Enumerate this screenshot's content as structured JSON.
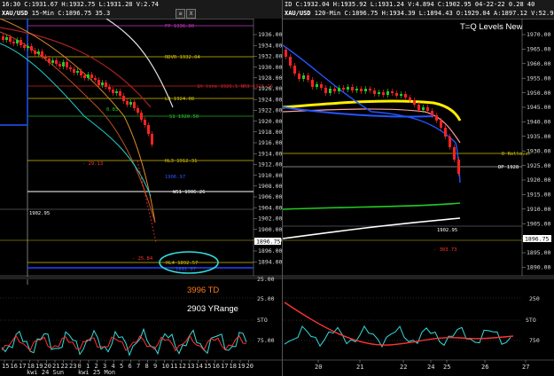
{
  "left": {
    "header_line1": "16:30 C:1931.67 H:1932.75 L:1931.28 V:2.74",
    "header_line2": "C:1932.74 V:2.78 C:1902.95 04-22-22 13:40",
    "symbol": "XAU/USD",
    "interval": "15-Min",
    "price": "C:1896.75",
    "extra": "35.3",
    "buttons": [
      "≡",
      "X"
    ],
    "price_axis": [
      "1936.00",
      "1934.00",
      "1932.00",
      "1930.00",
      "1928.00",
      "1926.00",
      "1924.00",
      "1922.00",
      "1920.00",
      "1918.00",
      "1916.00",
      "1914.00",
      "1912.00",
      "1910.00",
      "1908.00",
      "1906.00",
      "1904.00",
      "1902.00",
      "1900.00",
      "1898.00",
      "1896.00",
      "1894.00"
    ],
    "current_price_tag": "1896.75",
    "levels": [
      {
        "label": "FP 1936.00",
        "color": "#cc33cc"
      },
      {
        "label": "RDVR 1932.04",
        "color": "#d4c000"
      },
      {
        "label": "1H line 1926.1 NR3 1926.16",
        "color": "#cc2222"
      },
      {
        "label": "L3 1924.08",
        "color": "#d4c000"
      },
      {
        "label": "S1 1920.50",
        "color": "#22cc22"
      },
      {
        "label": "HL3 1912.31",
        "color": "#d4c000"
      },
      {
        "label": "WS1 1906.26",
        "color": "#ffffff"
      },
      {
        "label": "HL4 1892.57",
        "color": "#d4c000"
      }
    ],
    "annot_close": "1902.95",
    "annot_red1": "- 29.13",
    "annot_red2": "- 25.84",
    "annot_green": "0.83",
    "annot_blue1": "1906.97",
    "annot_blue2": "1891.07",
    "big_text_1": "3996 TD",
    "big_text_2": "2903 YRange",
    "sub_axis": [
      "25.00",
      "STO",
      "75.00"
    ],
    "sub_axis_top": "25.00",
    "x_ticks": [
      "15",
      "16",
      "17",
      "18",
      "19",
      "20",
      "21",
      "22",
      "23",
      "0",
      "1",
      "2",
      "3",
      "4",
      "5",
      "6",
      "7",
      "8",
      "9",
      "10",
      "11",
      "12",
      "13",
      "14",
      "15",
      "16",
      "17",
      "18",
      "19",
      "20"
    ],
    "date_labels": [
      "kwi 24 Sun",
      "kwi 25 Mon"
    ]
  },
  "right": {
    "header_line1": "ID C:1932.04 H:1935.92 L:1931.24 V:4.894 C:1902.95 04-22-22 0.28 40",
    "header_line2": "",
    "symbol": "XAU/USD",
    "interval": "120-Min",
    "price": "C:1896.75 H:1934.39 L:1894.43 O:1929.04 A:1897.12 V:52.9K",
    "buttons": [
      "≡",
      "X"
    ],
    "title_overlay": "T=Q Levels New",
    "price_axis": [
      "1970.00",
      "1965.00",
      "1960.00",
      "1955.00",
      "1950.00",
      "1945.00",
      "1940.00",
      "1935.00",
      "1930.00",
      "1925.00",
      "1920.00",
      "1915.00",
      "1910.00",
      "1905.00",
      "1900.00",
      "1895.00",
      "1890.00"
    ],
    "current_price_tag": "1896.75",
    "levels": [
      {
        "label": "D Rollover",
        "color": "#d4c000"
      },
      {
        "label": "DP 1928",
        "color": "#ffffff"
      }
    ],
    "annot_close": "1902.95",
    "annot_red": "- 303.73",
    "sub_axis": [
      "250",
      "STO",
      "750"
    ],
    "x_ticks": [
      "20",
      "21",
      "22",
      "24",
      "25",
      "26",
      "27"
    ],
    "date_labels": [
      "24",
      "25"
    ]
  }
}
